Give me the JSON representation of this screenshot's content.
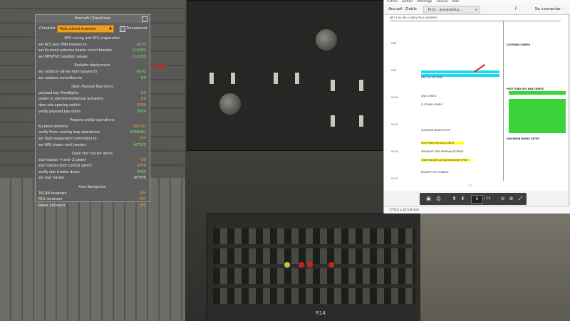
{
  "checklist": {
    "title": "Aircraft Checklists",
    "toolbar_label": "Checklist",
    "selected": "Post orbital insertion",
    "transparent_label": "Transparent",
    "sections": [
      {
        "heading": "MPS saving and RCS preparation",
        "items": [
          {
            "label": "set RCS and OMS heaters to",
            "value": "AUTO",
            "color": "#7ee06a"
          },
          {
            "label": "set Ku-band antenna heater circuit breaker",
            "value": "CLOSED",
            "color": "#7ee06a"
          },
          {
            "label": "set MPS/TVC isolation valves",
            "value": "CLOSED",
            "color": "#7ee06a"
          }
        ]
      },
      {
        "heading": "Radiator deployment",
        "items": [
          {
            "label": "set radiator valves from bypass to",
            "value": "AUTO",
            "color": "#7ee06a"
          },
          {
            "label": "set radiator controllers to",
            "value": "ON",
            "color": "#7ee06a"
          }
        ]
      },
      {
        "heading": "Open Payload Bay doors",
        "items": [
          {
            "label": "payload bay floodlights",
            "value": "ON",
            "color": "#f0a030"
          },
          {
            "label": "power to electromechanical actuators",
            "value": "ON",
            "color": "#f0a030"
          },
          {
            "label": "door sub opening switch",
            "value": "OPEN",
            "color": "#f0a030"
          },
          {
            "label": "verify payload bay doors",
            "value": "OPEN",
            "color": "#7ee06a"
          }
        ]
      },
      {
        "heading": "Prepare orbital operations",
        "items": [
          {
            "label": "Ku-band antenna",
            "value": "DEPLOY",
            "color": "#f0a030"
          },
          {
            "label": "verify Freon cooling loop operations",
            "value": "NOMINAL",
            "color": "#7ee06a"
          },
          {
            "label": "set flash evaporator controllers to",
            "value": "OFF",
            "color": "#f0a030"
          },
          {
            "label": "set APU steam vent heaters",
            "value": "ACTIVE",
            "color": "#7ee06a"
          }
        ]
      },
      {
        "heading": "Open star tracker doors",
        "items": [
          {
            "label": "star tracker -Y and -Z power",
            "value": "ON",
            "color": "#f0a030"
          },
          {
            "label": "star tracker door control switch",
            "value": "OPEN",
            "color": "#f0a030"
          },
          {
            "label": "verify star tracker doors",
            "value": "OPEN",
            "color": "#7ee06a"
          },
          {
            "label": "set star tracker",
            "value": "ACTIVE",
            "color": "#e6e6e6"
          }
        ]
      },
      {
        "heading": "Area Navigation",
        "items": [
          {
            "label": "TACAN receivers",
            "value": "OFF",
            "color": "#f0a030"
          },
          {
            "label": "MLS receivers",
            "value": "OFF",
            "color": "#f0a030"
          },
          {
            "label": "Radar altimeter",
            "value": "OFF",
            "color": "#f0a030"
          }
        ]
      }
    ]
  },
  "pdf": {
    "menu": [
      "Fichier",
      "Edition",
      "Affichage",
      "Favoris",
      "Aide"
    ],
    "nav_home": "Accueil",
    "nav_tools": "Outils",
    "tab_title": "PI CL - annotated.p...",
    "user": "Se connecter",
    "page_current": "8",
    "page_total": "/ 16",
    "page_label": "1-7",
    "status": "279,4 x 215,9 mm",
    "doc_header": "MET 1:00 MIS 1 (DAY) PTA 1 (ASCENT)",
    "times": [
      "0:50",
      "0:55",
      "01:00",
      "01:05",
      "01:10",
      "01:15"
    ],
    "right_titles": [
      "CLOTHING CONFIG",
      "POST PLBD OPS RAD CONFIG",
      "QUICKDON MASKS SETUP"
    ],
    "left_rows": [
      "OPS 201 OPS XFER",
      "SEAT CONFIG",
      "CLOTHING CONFIG",
      "QUICKDON MASKS SETUP",
      "POST PLBD OPS RAD CONFIG",
      "SPECIALIST SEAT REMOVAL/STORAGE",
      "STAR TRACKER ACTIVATION/DOOR OPEN",
      "ESCAPE POLE STOWAGE"
    ]
  },
  "scene": {
    "panel_label": "R14"
  }
}
